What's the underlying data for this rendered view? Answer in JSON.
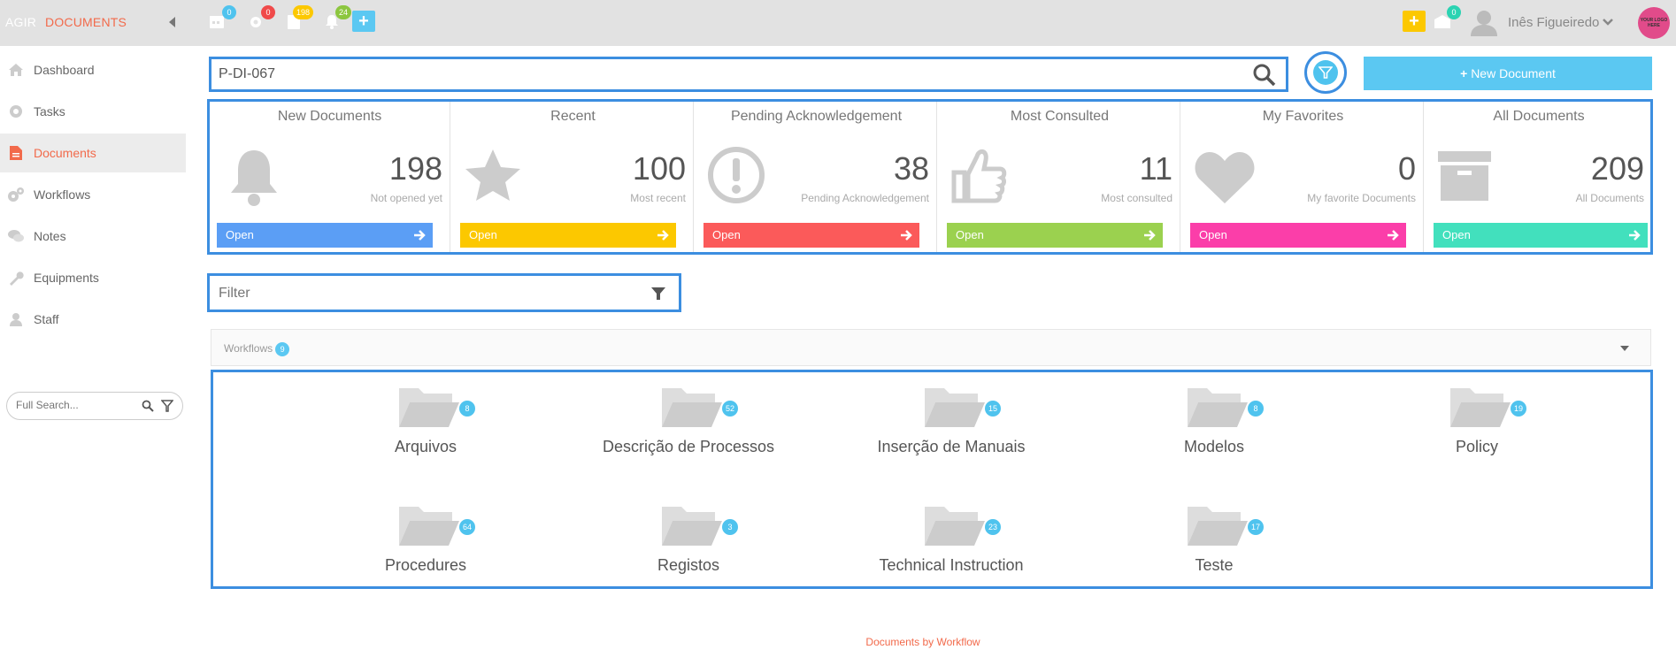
{
  "brand": {
    "part1": "AGIR",
    "part2": "DOCUMENTS"
  },
  "topbar": {
    "badges": {
      "calendar": "0",
      "settings": "0",
      "tasks": "198",
      "notifications": "24",
      "messages": "0"
    },
    "user_name": "Inês Figueiredo",
    "logo_text": "YOUR LOGO HERE"
  },
  "sidebar": {
    "items": [
      {
        "label": "Dashboard",
        "icon": "home-icon"
      },
      {
        "label": "Tasks",
        "icon": "gear-icon"
      },
      {
        "label": "Documents",
        "icon": "document-icon"
      },
      {
        "label": "Workflows",
        "icon": "gears-icon"
      },
      {
        "label": "Notes",
        "icon": "comments-icon"
      },
      {
        "label": "Equipments",
        "icon": "wrench-icon"
      },
      {
        "label": "Staff",
        "icon": "user-icon"
      }
    ],
    "full_search_placeholder": "Full Search..."
  },
  "search": {
    "value": "P-DI-067"
  },
  "new_document_label": "New Document",
  "cards": [
    {
      "title": "New Documents",
      "value": "198",
      "sub": "Not opened yet",
      "open": "Open",
      "color": "#5b9ef5",
      "icon": "bell-icon"
    },
    {
      "title": "Recent",
      "value": "100",
      "sub": "Most recent",
      "open": "Open",
      "color": "#fcc800",
      "icon": "star-icon"
    },
    {
      "title": "Pending Acknowledgement",
      "value": "38",
      "sub": "Pending Acknowledgement",
      "open": "Open",
      "color": "#fb5a5a",
      "icon": "exclamation-circle-icon"
    },
    {
      "title": "Most Consulted",
      "value": "11",
      "sub": "Most consulted",
      "open": "Open",
      "color": "#9bd14f",
      "icon": "thumbs-up-icon"
    },
    {
      "title": "My Favorites",
      "value": "0",
      "sub": "My favorite Documents",
      "open": "Open",
      "color": "#fb3ea9",
      "icon": "heart-icon"
    },
    {
      "title": "All Documents",
      "value": "209",
      "sub": "All Documents",
      "open": "Open",
      "color": "#42e0bd",
      "icon": "archive-icon"
    }
  ],
  "filter": {
    "placeholder": "Filter"
  },
  "workflows": {
    "label": "Workflows",
    "count": "9",
    "folders": [
      {
        "name": "Arquivos",
        "count": "8"
      },
      {
        "name": "Descrição de Processos",
        "count": "52"
      },
      {
        "name": "Inserção de Manuais",
        "count": "15"
      },
      {
        "name": "Modelos",
        "count": "8"
      },
      {
        "name": "Policy",
        "count": "19"
      },
      {
        "name": "Procedures",
        "count": "64"
      },
      {
        "name": "Registos",
        "count": "3"
      },
      {
        "name": "Technical Instruction",
        "count": "23"
      },
      {
        "name": "Teste",
        "count": "17"
      }
    ]
  },
  "footer": "Documents by Workflow"
}
